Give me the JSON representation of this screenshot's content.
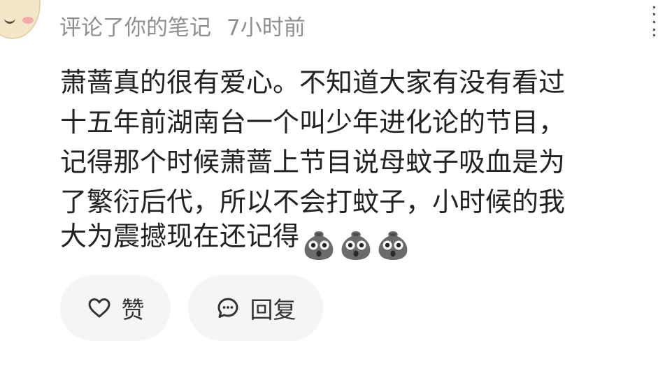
{
  "comment_meta": {
    "action_text": "评论了你的笔记",
    "time_ago": "7小时前"
  },
  "comment": {
    "lines": [
      "萧蔷真的很有爱心。不知道大家有没有看过",
      "十五年前湖南台一个叫少年进化论的节目，",
      "记得那个时候萧蔷上节目说母蚊子吸血是为",
      "了繁衍后代，所以不会打蚊子，小时候的我",
      "大为震撼现在还记得"
    ],
    "emojis": [
      "shocked-face-emoji",
      "shocked-face-emoji",
      "shocked-face-emoji"
    ]
  },
  "actions": {
    "like_label": "赞",
    "like_icon": "heart-outline-icon",
    "reply_label": "回复",
    "reply_icon": "chat-bubble-icon"
  },
  "colors": {
    "meta_text": "#8f8f8f",
    "body_text": "#222222",
    "pill_background": "#f5f5f5"
  }
}
